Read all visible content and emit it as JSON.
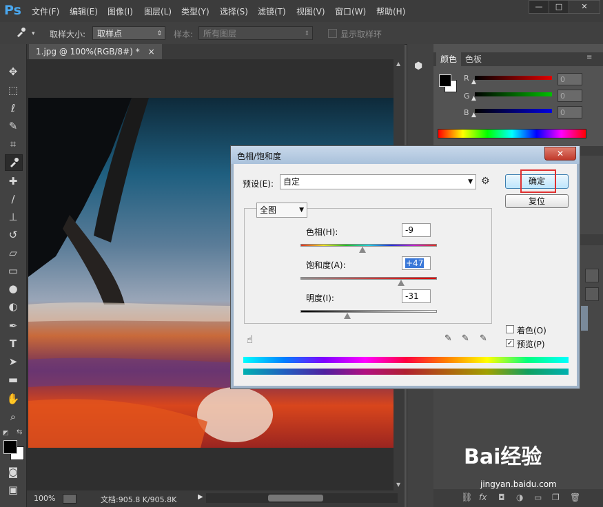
{
  "app": {
    "logo": "Ps",
    "menu": [
      "文件(F)",
      "编辑(E)",
      "图像(I)",
      "图层(L)",
      "类型(Y)",
      "选择(S)",
      "滤镜(T)",
      "视图(V)",
      "窗口(W)",
      "帮助(H)"
    ],
    "window_controls": [
      "—",
      "□",
      "✕"
    ]
  },
  "options_bar": {
    "sample_size_label": "取样大小:",
    "sample_size_value": "取样点",
    "sample_label": "样本:",
    "sample_value": "所有图层",
    "show_ring_label": "显示取样环"
  },
  "document": {
    "tab_label": "1.jpg @ 100%(RGB/8#) *",
    "tab_close": "×",
    "zoom": "100%",
    "doc_size": "文档:905.8 K/905.8K"
  },
  "color_panel": {
    "tabs": [
      "颜色",
      "色板"
    ],
    "channels": [
      {
        "label": "R",
        "value": "0",
        "color": "#e00000"
      },
      {
        "label": "G",
        "value": "0",
        "color": "#00c000"
      },
      {
        "label": "B",
        "value": "0",
        "color": "#0000e0"
      }
    ]
  },
  "dialog": {
    "title": "色相/饱和度",
    "close": "✕",
    "preset_label": "预设(E):",
    "preset_value": "自定",
    "channel_value": "全图",
    "hue_label": "色相(H):",
    "hue_value": "-9",
    "saturation_label": "饱和度(A):",
    "saturation_value": "+47",
    "lightness_label": "明度(I):",
    "lightness_value": "-31",
    "ok_label": "确定",
    "reset_label": "复位",
    "colorize_label": "着色(O)",
    "preview_label": "预览(P)",
    "colorize_checked": false,
    "preview_checked": true,
    "highlight_color": "#e03030"
  },
  "watermark": {
    "brand": "Bai经验",
    "url": "jingyan.baidu.com"
  }
}
